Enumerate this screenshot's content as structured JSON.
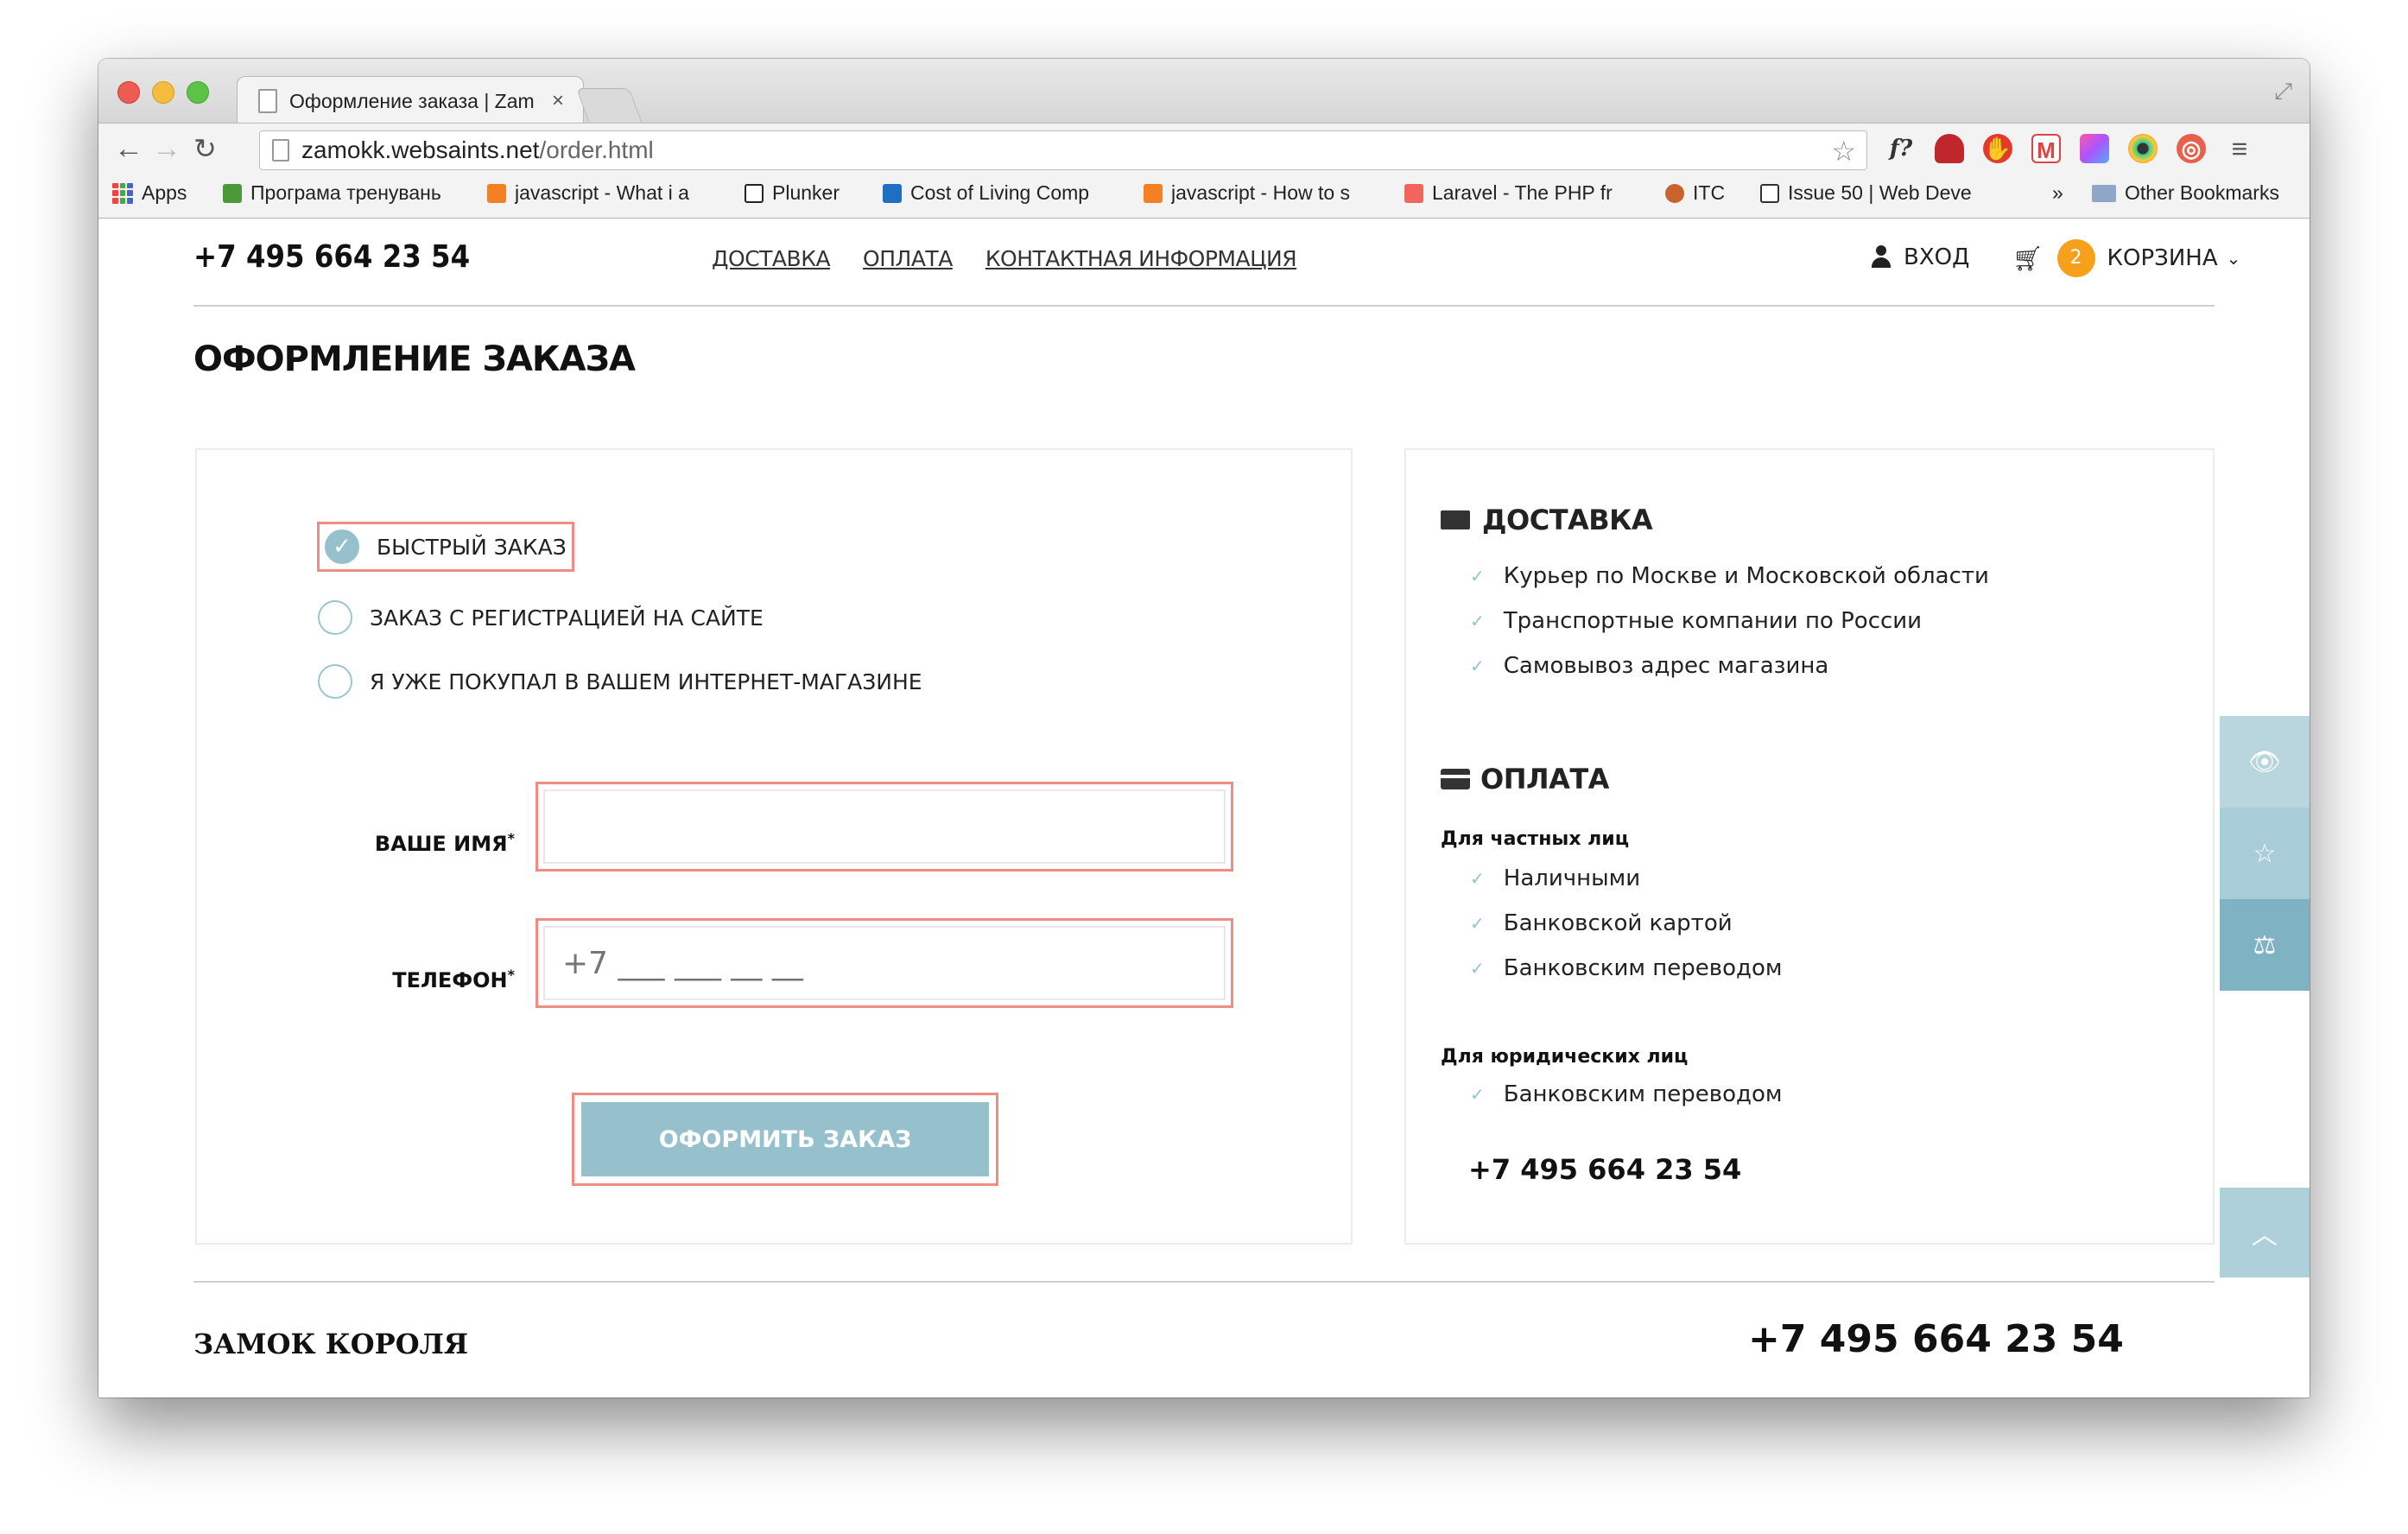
{
  "browser": {
    "tab_title": "Оформление заказа | Zam",
    "tab_close": "×",
    "url_host": "zamokk.websaints.net",
    "url_path": "/order.html",
    "bookmarks": [
      {
        "label": "Apps"
      },
      {
        "label": "Програма тренувань"
      },
      {
        "label": "javascript - What i a"
      },
      {
        "label": "Plunker"
      },
      {
        "label": "Cost of Living Comp"
      },
      {
        "label": "javascript - How to s"
      },
      {
        "label": "Laravel - The PHP fr"
      },
      {
        "label": "ITC"
      },
      {
        "label": "Issue 50 | Web Deve"
      }
    ],
    "bookmarks_overflow": "»",
    "other_bookmarks": "Other Bookmarks",
    "ext_fquery": "f?"
  },
  "header": {
    "phone": "+7 495 664 23 54",
    "nav": [
      "ДОСТАВКА",
      "ОПЛАТА",
      "КОНТАКТНАЯ ИНФОРМАЦИЯ"
    ],
    "login": "ВХОД",
    "cart_count": "2",
    "cart_label": "КОРЗИНА"
  },
  "page_title": "ОФОРМЛЕНИЕ ЗАКАЗА",
  "order_form": {
    "options": [
      {
        "label": "БЫСТРЫЙ ЗАКАЗ",
        "checked": true
      },
      {
        "label": "ЗАКАЗ С РЕГИСТРАЦИЕЙ НА САЙТЕ",
        "checked": false
      },
      {
        "label": "Я УЖЕ ПОКУПАЛ В ВАШЕМ ИНТЕРНЕТ-МАГАЗИНЕ",
        "checked": false
      }
    ],
    "name_label": "ВАШЕ ИМЯ",
    "phone_label": "ТЕЛЕФОН",
    "required_mark": "*",
    "name_value": "",
    "phone_placeholder": "+7 ___ ___ __ __",
    "submit_label": "ОФОРМИТЬ ЗАКАЗ"
  },
  "info": {
    "delivery_title": "ДОСТАВКА",
    "delivery_items": [
      "Курьер по Москве и Московской области",
      "Транспортные компании по России",
      "Самовывоз адрес магазина"
    ],
    "payment_title": "ОПЛАТА",
    "private_title": "Для частных лиц",
    "private_items": [
      "Наличными",
      "Банковской картой",
      "Банковским переводом"
    ],
    "legal_title": "Для юридических лиц",
    "legal_items": [
      "Банковским переводом"
    ],
    "phone": "+7 495 664 23 54"
  },
  "side_tabs": {
    "colors": [
      "#b9d6de",
      "#a9cdd8",
      "#7fb2c2"
    ],
    "icons": [
      "eye-icon",
      "star-icon",
      "scales-icon"
    ]
  },
  "footer": {
    "brand": "ЗАМОК КОРОЛЯ",
    "phone": "+7 495 664 23 54"
  },
  "colors": {
    "accent": "#97c0cd",
    "badge": "#f7a01b",
    "highlight": "#f08b86"
  }
}
